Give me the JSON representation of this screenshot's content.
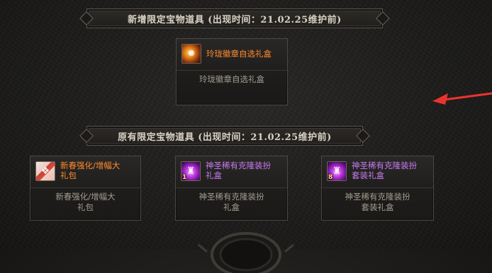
{
  "sections": [
    {
      "title": "新增限定宝物道具 (出现时间：21.02.25维护前)",
      "items": [
        {
          "name_lines": [
            "玲珑徽章自选礼盒"
          ],
          "desc_lines": [
            "玲珑徽章自选礼盒"
          ],
          "icon": "gold-emblem-icon",
          "name_color": "#ff8a2e",
          "count": ""
        }
      ]
    },
    {
      "title": "原有限定宝物道具 (出现时间：21.02.25维护前)",
      "items": [
        {
          "name_lines": [
            "新春强化/增幅大",
            "礼包"
          ],
          "desc_lines": [
            "新春强化/增幅大",
            "礼包"
          ],
          "icon": "gift-box-icon",
          "name_color": "#ff8a2e",
          "count": ""
        },
        {
          "name_lines": [
            "神圣稀有克隆装扮",
            "礼盒"
          ],
          "desc_lines": [
            "神圣稀有克隆装扮",
            "礼盒"
          ],
          "icon": "purple-outfit-icon",
          "name_color": "#c77bf2",
          "count": "1"
        },
        {
          "name_lines": [
            "神圣稀有克隆装扮",
            "套装礼盒"
          ],
          "desc_lines": [
            "神圣稀有克隆装扮",
            "套装礼盒"
          ],
          "icon": "purple-outfit-set-icon",
          "name_color": "#c77bf2",
          "count": "8"
        }
      ]
    }
  ]
}
